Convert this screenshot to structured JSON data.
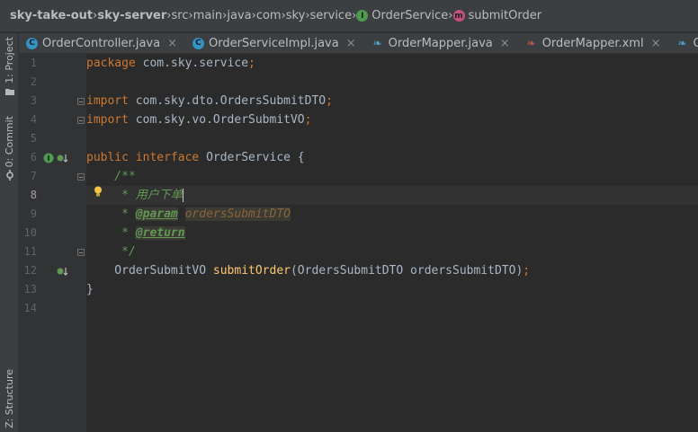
{
  "breadcrumb": [
    {
      "label": "sky-take-out",
      "bold": true
    },
    {
      "label": "sky-server",
      "bold": true
    },
    {
      "label": "src"
    },
    {
      "label": "main"
    },
    {
      "label": "java"
    },
    {
      "label": "com"
    },
    {
      "label": "sky"
    },
    {
      "label": "service"
    },
    {
      "label": "OrderService",
      "icon": "I"
    },
    {
      "label": "submitOrder",
      "icon": "m"
    }
  ],
  "tool_windows": {
    "project": "1: Project",
    "commit": "0: Commit",
    "structure": "Z: Structure"
  },
  "tabs": [
    {
      "label": "OrderController.java",
      "icon": "C",
      "icon_name": "class-icon"
    },
    {
      "label": "OrderServiceImpl.java",
      "icon": "C",
      "icon_name": "class-icon"
    },
    {
      "label": "OrderMapper.java",
      "icon": "mapper",
      "icon_name": "mybatis-bird-icon"
    },
    {
      "label": "OrderMapper.xml",
      "icon": "mapper",
      "icon_name": "mybatis-xml-icon"
    },
    {
      "label": "OrderDetai",
      "icon": "mapper",
      "icon_name": "mybatis-bird-icon"
    }
  ],
  "tab_close": "×",
  "editor": {
    "current_line": 8,
    "lines": [
      {
        "n": "1",
        "tokens": [
          {
            "t": "package ",
            "c": "kw"
          },
          {
            "t": "com.sky.service",
            "c": "pl"
          },
          {
            "t": ";",
            "c": "kw"
          }
        ]
      },
      {
        "n": "2",
        "tokens": []
      },
      {
        "n": "3",
        "tokens": [
          {
            "t": "import ",
            "c": "kw"
          },
          {
            "t": "com.sky.dto.OrdersSubmitDTO",
            "c": "pl"
          },
          {
            "t": ";",
            "c": "kw"
          }
        ]
      },
      {
        "n": "4",
        "tokens": [
          {
            "t": "import ",
            "c": "kw"
          },
          {
            "t": "com.sky.vo.OrderSubmitVO",
            "c": "pl"
          },
          {
            "t": ";",
            "c": "kw"
          }
        ]
      },
      {
        "n": "5",
        "tokens": []
      },
      {
        "n": "6",
        "tokens": [
          {
            "t": "public interface ",
            "c": "kw"
          },
          {
            "t": "OrderService {",
            "c": "pl"
          }
        ]
      },
      {
        "n": "7",
        "tokens": [
          {
            "t": "    /**",
            "c": "doc"
          }
        ]
      },
      {
        "n": "8",
        "tokens": [
          {
            "t": "     * 用户下单",
            "c": "doc"
          }
        ]
      },
      {
        "n": "9",
        "tokens": [
          {
            "t": "     * ",
            "c": "doc"
          },
          {
            "t": "@param",
            "c": "tag"
          },
          {
            "t": " ",
            "c": "doc"
          },
          {
            "t": "ordersSubmitDTO",
            "c": "pval"
          }
        ]
      },
      {
        "n": "10",
        "tokens": [
          {
            "t": "     * ",
            "c": "doc"
          },
          {
            "t": "@return",
            "c": "tag"
          }
        ]
      },
      {
        "n": "11",
        "tokens": [
          {
            "t": "     */",
            "c": "doc"
          }
        ]
      },
      {
        "n": "12",
        "tokens": [
          {
            "t": "    OrderSubmitVO ",
            "c": "pl"
          },
          {
            "t": "submitOrder",
            "c": "fn"
          },
          {
            "t": "(OrdersSubmitDTO ordersSubmitDTO)",
            "c": "pl"
          },
          {
            "t": ";",
            "c": "kw"
          }
        ]
      },
      {
        "n": "13",
        "tokens": [
          {
            "t": "}",
            "c": "pl"
          }
        ]
      },
      {
        "n": "14",
        "tokens": []
      }
    ]
  },
  "colors": {
    "keyword": "#cc7832",
    "function": "#ffc66d",
    "doc_comment": "#629755",
    "plain": "#a9b7c6",
    "background": "#2b2b2b"
  }
}
